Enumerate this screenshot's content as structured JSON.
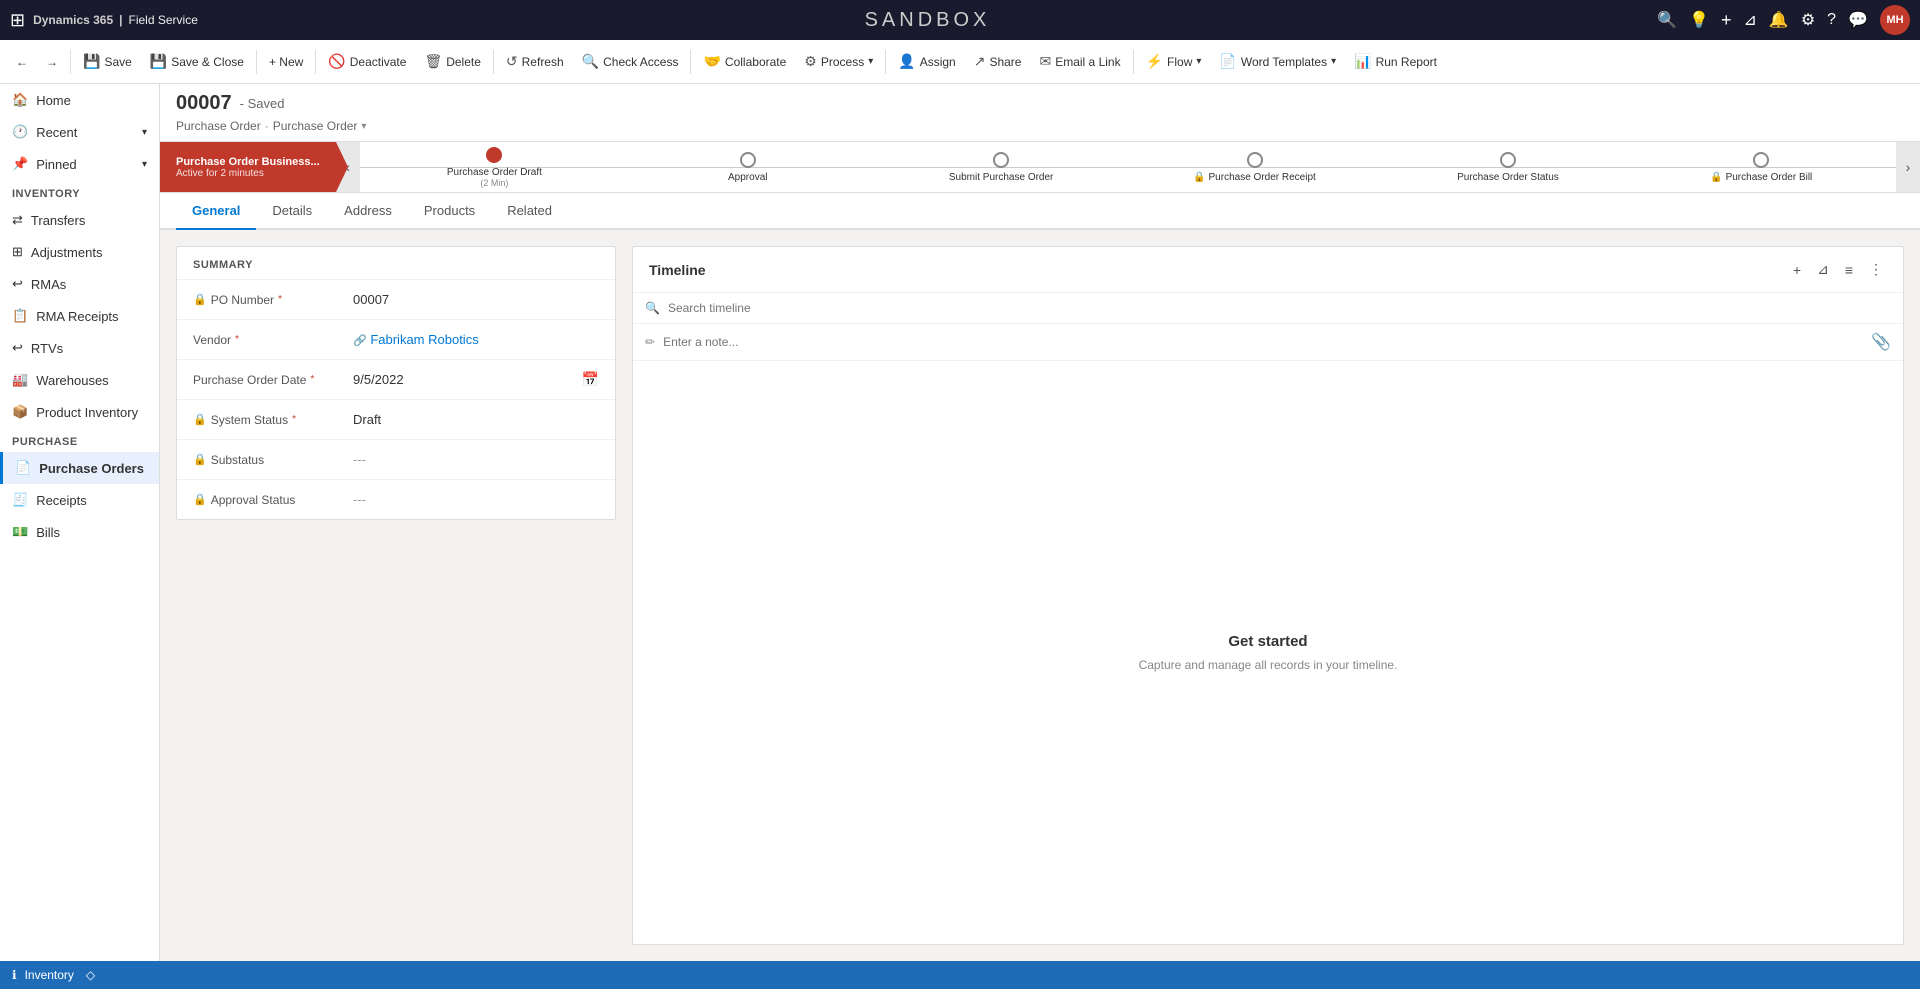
{
  "topNav": {
    "gridIcon": "⊞",
    "brand": "Dynamics 365",
    "separator": "|",
    "app": "Field Service",
    "title": "SANDBOX",
    "icons": {
      "search": "🔍",
      "lightbulb": "💡",
      "plus": "+",
      "filter": "⊿",
      "bell": "🔔",
      "gear": "⚙",
      "question": "?",
      "chat": "💬"
    },
    "avatar": "MH"
  },
  "toolbar": {
    "backLabel": "←",
    "forwardLabel": "→",
    "saveLabel": "Save",
    "saveCloseLabel": "Save & Close",
    "newLabel": "+ New",
    "deactivateLabel": "Deactivate",
    "deleteLabel": "Delete",
    "refreshLabel": "Refresh",
    "checkAccessLabel": "Check Access",
    "collaborateLabel": "Collaborate",
    "processLabel": "Process",
    "assignLabel": "Assign",
    "shareLabel": "Share",
    "emailLinkLabel": "Email a Link",
    "flowLabel": "Flow",
    "wordTemplatesLabel": "Word Templates",
    "runReportLabel": "Run Report"
  },
  "sidebar": {
    "homeLabel": "Home",
    "recentLabel": "Recent",
    "pinnedLabel": "Pinned",
    "inventorySection": "Inventory",
    "inventoryItems": [
      {
        "label": "Transfers"
      },
      {
        "label": "Adjustments"
      },
      {
        "label": "RMAs"
      },
      {
        "label": "RMA Receipts"
      },
      {
        "label": "RTVs"
      },
      {
        "label": "Warehouses"
      },
      {
        "label": "Product Inventory"
      }
    ],
    "purchaseSection": "Purchase",
    "purchaseItems": [
      {
        "label": "Purchase Orders",
        "active": true
      },
      {
        "label": "Receipts"
      },
      {
        "label": "Bills"
      }
    ]
  },
  "record": {
    "id": "00007",
    "status": "Saved",
    "breadcrumb1": "Purchase Order",
    "breadcrumb2": "Purchase Order",
    "bpf": {
      "activeStage": "Purchase Order Business...",
      "activeSubtitle": "Active for 2 minutes",
      "stages": [
        {
          "label": "Purchase Order Draft",
          "sublabel": "(2 Min)",
          "active": true,
          "locked": false
        },
        {
          "label": "Approval",
          "sublabel": "",
          "active": false,
          "locked": false
        },
        {
          "label": "Submit Purchase Order",
          "sublabel": "",
          "active": false,
          "locked": false
        },
        {
          "label": "Purchase Order Receipt",
          "sublabel": "",
          "active": false,
          "locked": true
        },
        {
          "label": "Purchase Order Status",
          "sublabel": "",
          "active": false,
          "locked": false
        },
        {
          "label": "Purchase Order Bill",
          "sublabel": "",
          "active": false,
          "locked": true
        }
      ]
    }
  },
  "tabs": [
    {
      "label": "General",
      "active": true
    },
    {
      "label": "Details",
      "active": false
    },
    {
      "label": "Address",
      "active": false
    },
    {
      "label": "Products",
      "active": false
    },
    {
      "label": "Related",
      "active": false
    }
  ],
  "summary": {
    "sectionTitle": "SUMMARY",
    "fields": [
      {
        "name": "poNumber",
        "label": "PO Number",
        "required": true,
        "value": "00007",
        "hasIcon": false,
        "hasCalendar": false,
        "isLink": false
      },
      {
        "name": "vendor",
        "label": "Vendor",
        "required": true,
        "value": "Fabrikam Robotics",
        "hasIcon": false,
        "hasCalendar": false,
        "isLink": true
      },
      {
        "name": "purchaseOrderDate",
        "label": "Purchase Order Date",
        "required": true,
        "value": "9/5/2022",
        "hasIcon": false,
        "hasCalendar": true,
        "isLink": false
      },
      {
        "name": "systemStatus",
        "label": "System Status",
        "required": true,
        "value": "Draft",
        "hasIcon": true,
        "hasCalendar": false,
        "isLink": false
      },
      {
        "name": "substatus",
        "label": "Substatus",
        "required": false,
        "value": "---",
        "hasIcon": true,
        "hasCalendar": false,
        "isLink": false
      },
      {
        "name": "approvalStatus",
        "label": "Approval Status",
        "required": false,
        "value": "---",
        "hasIcon": true,
        "hasCalendar": false,
        "isLink": false
      }
    ]
  },
  "timeline": {
    "title": "Timeline",
    "searchPlaceholder": "Search timeline",
    "notePlaceholder": "Enter a note...",
    "emptyTitle": "Get started",
    "emptyDesc": "Capture and manage all records in your timeline."
  },
  "statusBar": {
    "icon": "ℹ",
    "label": "Inventory"
  }
}
